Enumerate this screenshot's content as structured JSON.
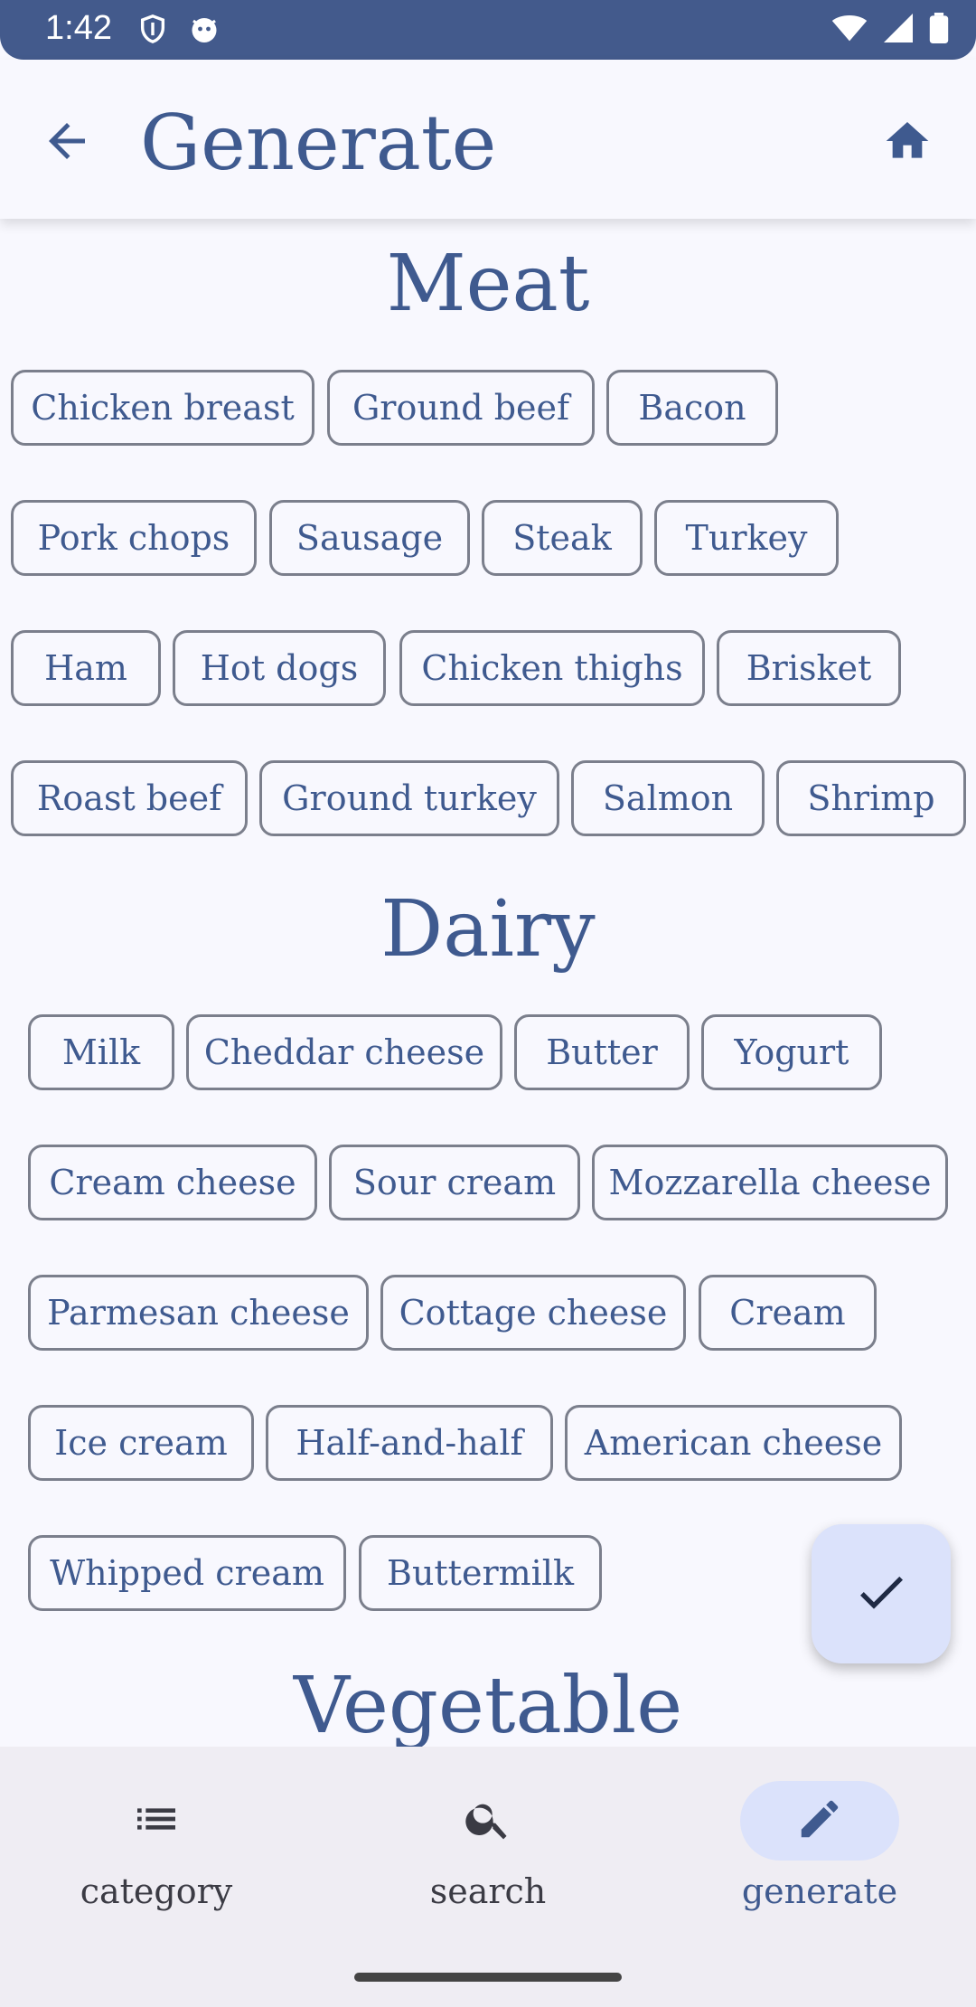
{
  "status": {
    "time": "1:42"
  },
  "app_bar": {
    "title": "Generate"
  },
  "sections": [
    {
      "title": "Meat",
      "items": [
        "Chicken breast",
        "Ground beef",
        "Bacon",
        "Pork chops",
        "Sausage",
        "Steak",
        "Turkey",
        "Ham",
        "Hot dogs",
        "Chicken thighs",
        "Brisket",
        "Roast beef",
        "Ground turkey",
        "Salmon",
        "Shrimp"
      ]
    },
    {
      "title": "Dairy",
      "items": [
        "Milk",
        "Cheddar cheese",
        "Butter",
        "Yogurt",
        "Cream cheese",
        "Sour cream",
        "Mozzarella cheese",
        "Parmesan cheese",
        "Cottage cheese",
        "Cream",
        "Ice cream",
        "Half-and-half",
        "American cheese",
        "Whipped cream",
        "Buttermilk"
      ]
    },
    {
      "title": "Vegetable",
      "items": []
    }
  ],
  "bottom_nav": {
    "items": [
      {
        "label": "category",
        "icon": "list-icon",
        "active": false
      },
      {
        "label": "search",
        "icon": "search-icon",
        "active": false
      },
      {
        "label": "generate",
        "icon": "edit-icon",
        "active": true
      }
    ]
  },
  "colors": {
    "primary": "#3f5a8f",
    "status_bar": "#435a8c",
    "active_pill": "#dbe2fb"
  }
}
